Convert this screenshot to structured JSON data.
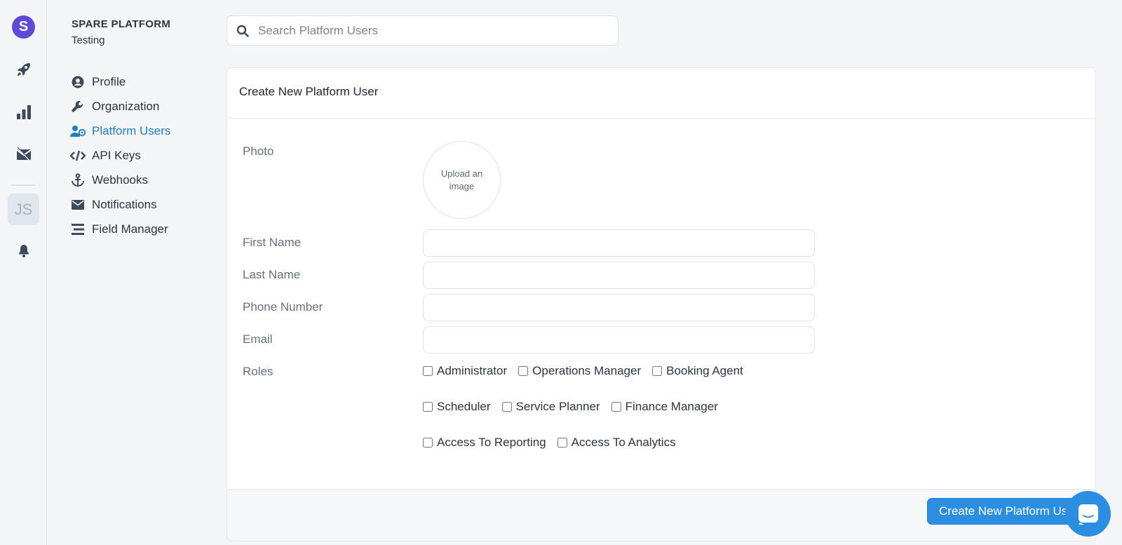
{
  "rail": {
    "logo_letter": "S",
    "avatar_initials": "JS",
    "icons": [
      "rocket-icon",
      "bar-chart-icon",
      "mail-icon",
      "bell-icon"
    ]
  },
  "org": {
    "name": "SPARE PLATFORM",
    "subtitle": "Testing"
  },
  "nav": {
    "items": [
      {
        "label": "Profile",
        "icon": "user-circle-icon"
      },
      {
        "label": "Organization",
        "icon": "wrench-icon"
      },
      {
        "label": "Platform Users",
        "icon": "users-icon",
        "active": true
      },
      {
        "label": "API Keys",
        "icon": "code-icon"
      },
      {
        "label": "Webhooks",
        "icon": "anchor-icon"
      },
      {
        "label": "Notifications",
        "icon": "envelope-icon"
      },
      {
        "label": "Field Manager",
        "icon": "list-icon"
      }
    ]
  },
  "search": {
    "placeholder": "Search Platform Users",
    "value": ""
  },
  "form": {
    "title": "Create New Platform User",
    "photo_label": "Photo",
    "photo_upload": "Upload an image",
    "first_name_label": "First Name",
    "last_name_label": "Last Name",
    "phone_label": "Phone Number",
    "email_label": "Email",
    "roles_label": "Roles",
    "roles": [
      {
        "label": "Administrator",
        "checked": false
      },
      {
        "label": "Operations Manager",
        "checked": false
      },
      {
        "label": "Booking Agent",
        "checked": false
      },
      {
        "label": "Scheduler",
        "checked": false
      },
      {
        "label": "Service Planner",
        "checked": false
      },
      {
        "label": "Finance Manager",
        "checked": false
      },
      {
        "label": "Access To Reporting",
        "checked": false
      },
      {
        "label": "Access To Analytics",
        "checked": false
      }
    ],
    "submit_label": "Create New Platform Us"
  },
  "colors": {
    "accent": "#1b7ec2",
    "primary_button": "#2b8ee0",
    "logo": "#5b4bd6"
  }
}
